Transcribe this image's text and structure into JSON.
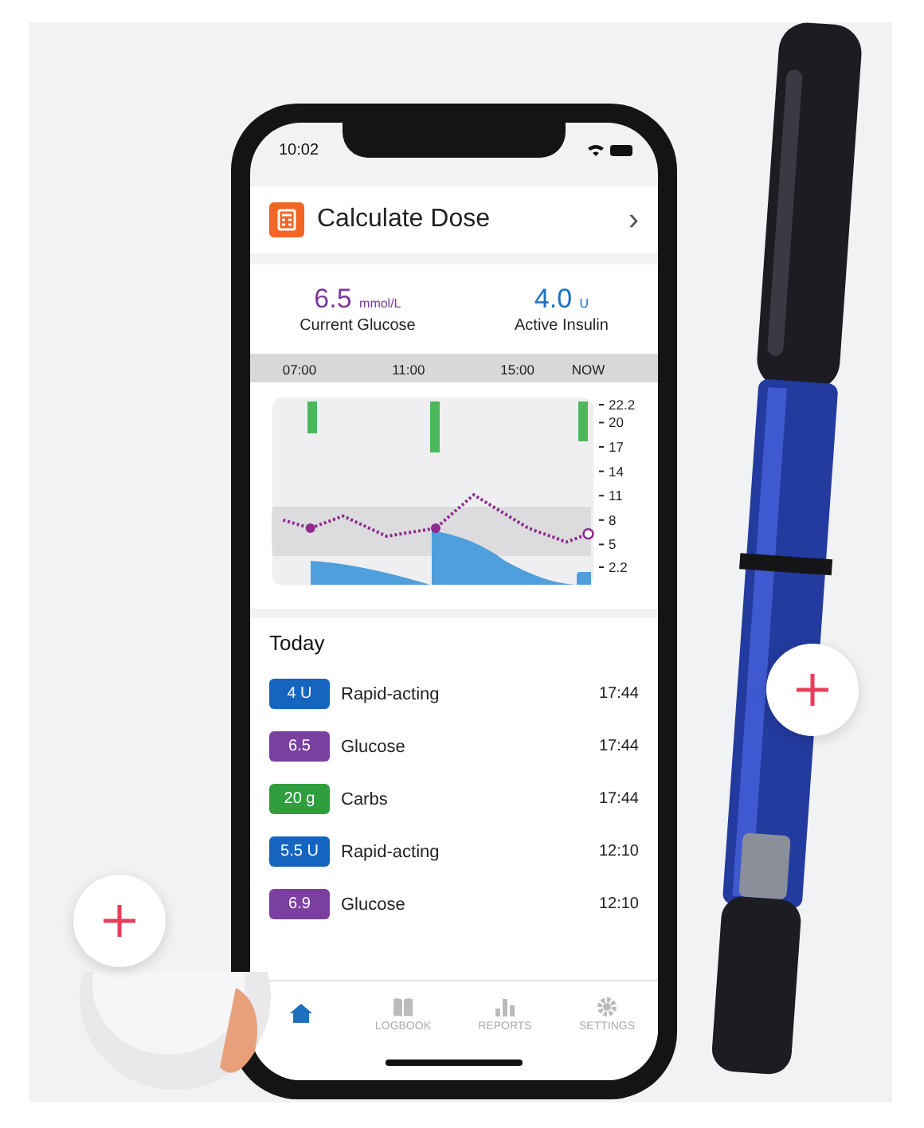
{
  "status_bar": {
    "time": "10:02"
  },
  "calculate_dose": {
    "label": "Calculate Dose",
    "chevron": "›"
  },
  "summary": [
    {
      "value": "6.5",
      "unit": "mmol/L",
      "label": "Current Glucose",
      "color": "#7b3a9a"
    },
    {
      "value": "4.0",
      "unit": "U",
      "label": "Active Insulin",
      "color": "#1e6fc0"
    }
  ],
  "chart": {
    "chart_data": {
      "type": "line",
      "x": [
        6.4,
        7.4,
        8.6,
        10.2,
        12,
        13.4,
        15.4,
        16.8,
        17.6
      ],
      "series": [
        {
          "color": "#8e2a8e",
          "line_style": "dotted",
          "values": [
            8,
            7,
            8.5,
            6,
            7,
            11.1,
            7,
            5.3,
            6.3
          ]
        }
      ],
      "xlim": [
        6,
        17.8
      ],
      "ylim": [
        0,
        23
      ],
      "xticks": [
        {
          "value": 7,
          "label": "07:00"
        },
        {
          "value": 11,
          "label": "11:00"
        },
        {
          "value": 15,
          "label": "15:00"
        },
        {
          "value": 17.6,
          "label": "NOW"
        }
      ],
      "yticks": [
        2.2,
        5,
        8,
        11,
        14,
        17,
        20,
        22.2
      ]
    }
  },
  "today": {
    "title": "Today",
    "entries": [
      {
        "badge": "4 U",
        "label": "Rapid-acting",
        "time": "17:44",
        "color": "#1565c0"
      },
      {
        "badge": "6.5",
        "label": "Glucose",
        "time": "17:44",
        "color": "#7b3fa0"
      },
      {
        "badge": "20 g",
        "label": "Carbs",
        "time": "17:44",
        "color": "#2e9e3e"
      },
      {
        "badge": "5.5 U",
        "label": "Rapid-acting",
        "time": "12:10",
        "color": "#1565c0"
      },
      {
        "badge": "6.9",
        "label": "Glucose",
        "time": "12:10",
        "color": "#7b3fa0"
      }
    ]
  },
  "tabs": [
    {
      "kind": "home",
      "selected": true
    },
    {
      "kind": "logbook",
      "label": "LOGBOOK",
      "selected": false
    },
    {
      "kind": "reports",
      "label": "REPORTS",
      "selected": false
    },
    {
      "kind": "settings",
      "label": "SETTINGS",
      "selected": false
    }
  ]
}
